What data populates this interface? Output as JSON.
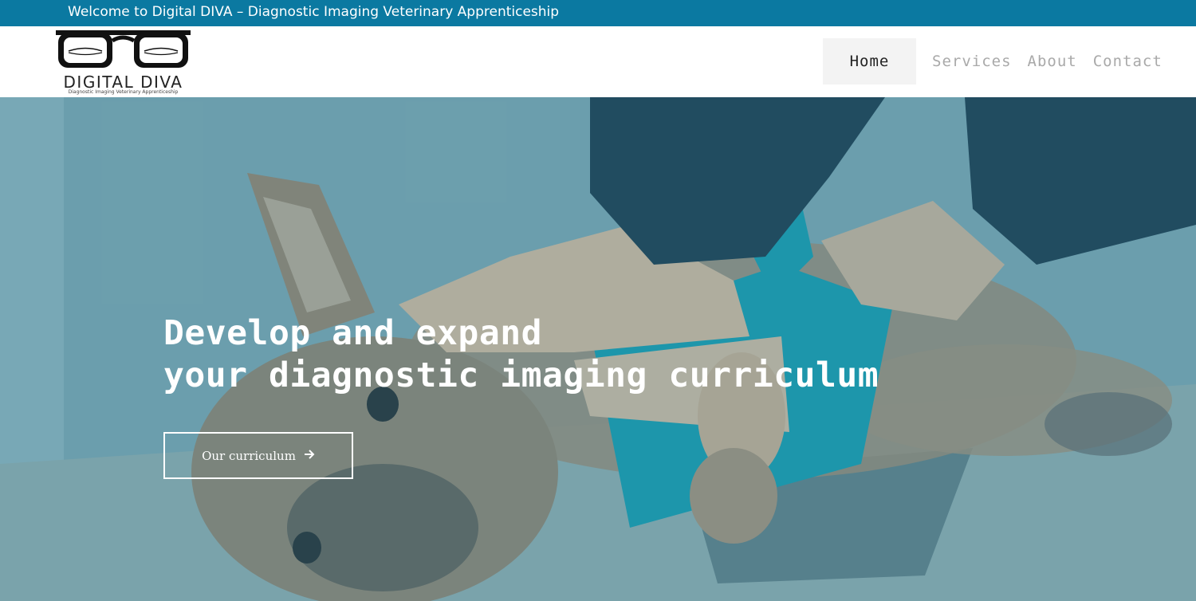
{
  "topbar": {
    "welcome": "Welcome to Digital DIVA – Diagnostic Imaging Veterinary Apprenticeship"
  },
  "logo": {
    "title": "DIGITAL DIVA",
    "tagline": "Diagnostic Imaging Veterinary Apprenticeship"
  },
  "nav": {
    "items": [
      {
        "label": "Home"
      },
      {
        "label": "Services"
      },
      {
        "label": "About"
      },
      {
        "label": "Contact"
      }
    ]
  },
  "hero": {
    "headline_line1": "Develop and expand",
    "headline_line2": "your diagnostic imaging curriculum",
    "cta_label": "Our curriculum",
    "cta_icon": "arrow-right-icon",
    "image_subject": "dog-on-exam-table-photo"
  },
  "colors": {
    "topbar_bg": "#0b79a1",
    "text_light": "#ffffff",
    "nav_active_bg": "#f3f3f3",
    "nav_inactive": "#a9a9a9"
  }
}
